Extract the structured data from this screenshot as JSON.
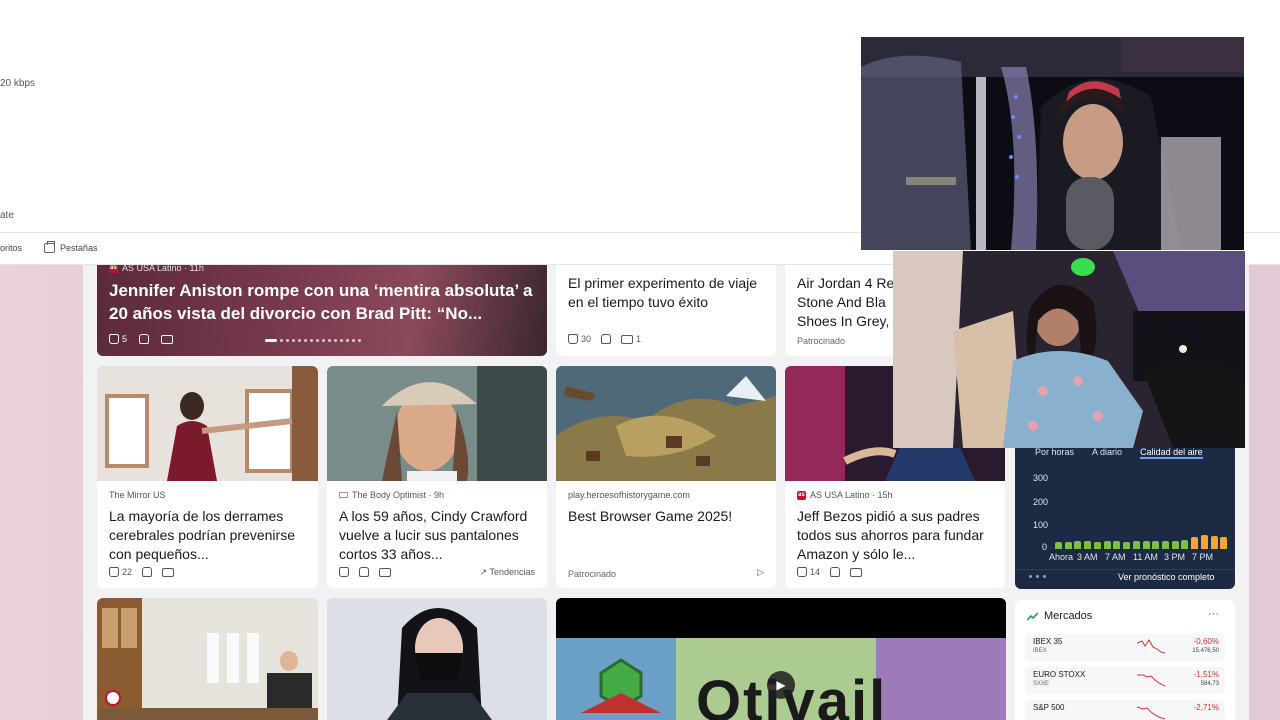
{
  "browser": {
    "bitrate_text": "20 kbps",
    "partial_label": "ate",
    "favorites_label": "oritos",
    "tabs_label": "Pestañas"
  },
  "hero": {
    "source": "AS USA Latino · 11h",
    "title": "Jennifer Aniston rompe con una ‘mentira absoluta’ a 20 años vista del divorcio con Brad Pitt: “No...",
    "likes": "5"
  },
  "top_cards": [
    {
      "source": "",
      "title": "El primer experimento de viaje en el tiempo tuvo éxito",
      "likes": "30",
      "comments": "1"
    },
    {
      "source": "",
      "title": "Air Jordan 4 Re Stone And Bla Shoes In Grey,",
      "sponsored": "Patrocinado"
    }
  ],
  "cards": [
    {
      "source": "The Mirror US",
      "title": "La mayoría de los derrames cerebrales podrían prevenirse con pequeños...",
      "likes": "22"
    },
    {
      "source": "The Body Optimist · 9h",
      "title": "A los 59 años, Cindy Crawford vuelve a lucir sus pantalones cortos 33 años...",
      "trending": "Tendencias"
    },
    {
      "source": "play.heroesofhistorygame.com",
      "title": "Best Browser Game 2025!",
      "sponsored": "Patrocinado"
    },
    {
      "source": "AS USA Latino · 15h",
      "title": "Jeff Bezos pidió a sus padres todos sus ahorros para fundar Amazon y sólo le...",
      "likes": "14"
    }
  ],
  "video_card": {
    "text": "Otivail"
  },
  "weather": {
    "tabs": [
      "Por horas",
      "A diario",
      "Calidad del aire"
    ],
    "active_tab": "Calidad del aire",
    "y_labels": [
      "300",
      "200",
      "100",
      "0"
    ],
    "x_labels": [
      "Ahora",
      "3 AM",
      "7 AM",
      "11 AM",
      "3 PM",
      "7 PM"
    ],
    "aqi_values": [
      32,
      32,
      33,
      33,
      32,
      33,
      33,
      32,
      33,
      33,
      34,
      34,
      35,
      38,
      52,
      58,
      55,
      50
    ],
    "link": "Ver pronóstico completo",
    "colors": {
      "good": "#7ac142",
      "moderate": "#f0a830"
    }
  },
  "markets": {
    "title": "Mercados",
    "more": "···",
    "rows": [
      {
        "name": "IBEX 35",
        "symbol": "IBEX",
        "change": "-0,60%",
        "value": "15.476,50"
      },
      {
        "name": "EURO STOXX",
        "symbol": "SXXE",
        "change": "-1,51%",
        "value": "584,73"
      },
      {
        "name": "S&P 500",
        "symbol": "",
        "change": "-2,71%",
        "value": ""
      }
    ]
  }
}
